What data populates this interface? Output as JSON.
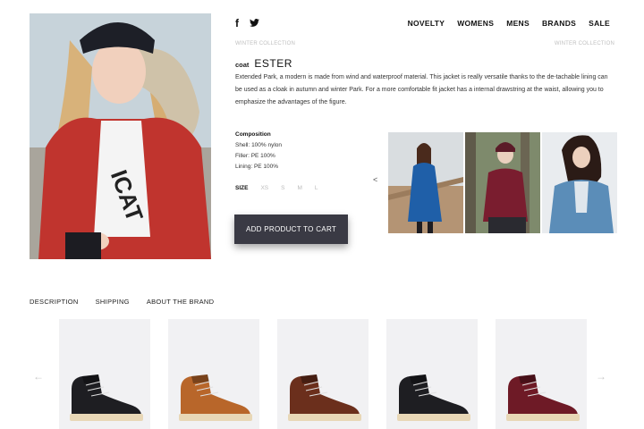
{
  "social": {
    "facebook_glyph": "f",
    "twitter_glyph": "t"
  },
  "nav": [
    "NOVELTY",
    "WOMENS",
    "MENS",
    "BRANDS",
    "SALE"
  ],
  "breadcrumb": {
    "left": "WINTER COLLECTION",
    "right": "WINTER COLLECTION"
  },
  "product": {
    "kind": "coat",
    "name": "ESTER",
    "description": "Extended Park, a modern is made from wind and waterproof material. This jacket is really versatile thanks to the de-tachable lining can be used as a cloak in autumn and winter Park. For a more comfortable fit jacket has a internal drawstring at the waist, allowing you to emphasize the advantages of the figure."
  },
  "composition": {
    "heading": "Composition",
    "lines": [
      "Shell: 100% nylon",
      "Filler: PE 100%",
      "Lining: PE 100%"
    ]
  },
  "size": {
    "label": "SIZE",
    "options": [
      "XS",
      "S",
      "M",
      "L"
    ]
  },
  "cart_button": "ADD PRODUCT TO CART",
  "thumbnail_prev": "<",
  "tabs": [
    "DESCRIPTION",
    "SHIPPING",
    "ABOUT THE BRAND"
  ],
  "carousel": {
    "prev": "←",
    "next": "→"
  },
  "colors": {
    "coat_red": "#c0342e",
    "coat_blue": "#1f5fa8",
    "coat_burgundy": "#7a1d2f",
    "coat_lightblue": "#5b8db8",
    "button_bg": "#3a3a44",
    "boot_black": "#1e1e22",
    "boot_tan": "#b8662a",
    "boot_brown": "#6b2f1c",
    "boot_burgundy": "#6e1a26",
    "sole": "#e8d7b6"
  },
  "boots": [
    "black",
    "tan",
    "brown",
    "black",
    "burgundy"
  ]
}
